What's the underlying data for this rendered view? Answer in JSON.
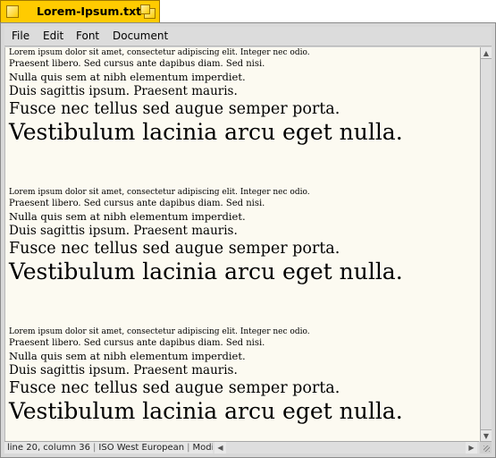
{
  "window": {
    "title": "Lorem-Ipsum.txt"
  },
  "menu": [
    "File",
    "Edit",
    "Font",
    "Document"
  ],
  "text_blocks": [
    [
      "Lorem ipsum dolor sit amet, consectetur adipiscing elit. Integer nec odio.",
      "Praesent libero. Sed cursus ante dapibus diam. Sed nisi.",
      "Nulla quis sem at nibh elementum imperdiet.",
      "Duis sagittis ipsum. Praesent mauris.",
      "Fusce nec tellus sed augue semper porta.",
      "Vestibulum lacinia arcu eget nulla."
    ],
    [
      "Lorem ipsum dolor sit amet, consectetur adipiscing elit. Integer nec odio.",
      "Praesent libero. Sed cursus ante dapibus diam. Sed nisi.",
      "Nulla quis sem at nibh elementum imperdiet.",
      "Duis sagittis ipsum. Praesent mauris.",
      "Fusce nec tellus sed augue semper porta.",
      "Vestibulum lacinia arcu eget nulla."
    ],
    [
      "Lorem ipsum dolor sit amet, consectetur adipiscing elit. Integer nec odio.",
      "Praesent libero. Sed cursus ante dapibus diam. Sed nisi.",
      "Nulla quis sem at nibh elementum imperdiet.",
      "Duis sagittis ipsum. Praesent mauris.",
      "Fusce nec tellus sed augue semper porta.",
      "Vestibulum lacinia arcu eget nulla."
    ]
  ],
  "status": {
    "position": "line 20, column 36",
    "encoding": "ISO West European",
    "state": "Modified"
  },
  "colors": {
    "tab": "#ffcb00",
    "page": "#fcfaf1",
    "chrome": "#d8d8d8"
  },
  "icons": [
    "close-icon",
    "zoom-icon",
    "scroll-up-icon",
    "scroll-down-icon",
    "scroll-left-icon",
    "scroll-right-icon",
    "resize-grip-icon"
  ]
}
